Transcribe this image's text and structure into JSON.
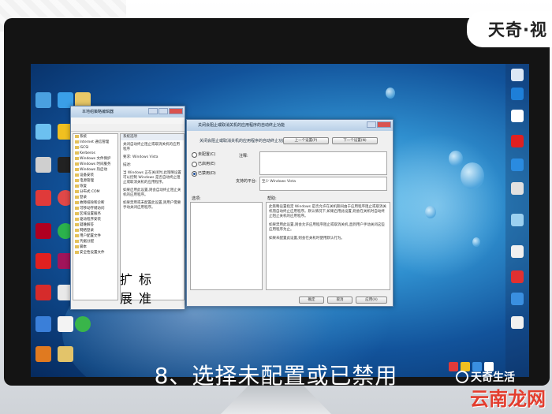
{
  "brand_top": "天奇·视",
  "caption": "8、选择未配置或已禁用",
  "watermark_brand": "天奇生活",
  "watermark_site": "云南龙网",
  "colors": {
    "accent_red": "#e33d2e",
    "title_bar": "#b8cfe7",
    "desktop_blue": "#12539b"
  },
  "gpedit": {
    "title": "本地组策略编辑器",
    "tree": [
      "系统",
      "Internet 通信管理",
      "iSCSI",
      "Kerberos",
      "Windows 文件保护",
      "Windows 时间服务",
      "Windows 热启动",
      "设备安装",
      "电源管理",
      "恢复",
      "分布式 COM",
      "登录",
      "故障排除和诊断",
      "可移动存储访问",
      "区域设置服务",
      "驱动程序安装",
      "疑难解答",
      "网络登录",
      "用户配置文件",
      "凭据分配",
      "脚本",
      "安全性设置文件"
    ],
    "detail_header": "系统选项",
    "detail_paragraphs": [
      "关闭自动终止阻止或取消关机的应用程序",
      "要求: Windows Vista",
      "描述:",
      "当 Windows 正在关闭时,此策略设置可以控制 Windows 是否自动终止阻止或取消关机的应用程序。",
      "如果启用此设置,则会自动终止阻止关机的应用程序。",
      "如果禁用或未配置此设置,则用户需要手动关闭应用程序。"
    ],
    "tabs": [
      "扩展",
      "标准"
    ]
  },
  "dialog": {
    "title": "关闭会阻止或取消关机的应用程序的自动终止功能",
    "heading": "关闭会阻止或取消关机的应用程序的自动终止功能",
    "prev_button": "上一个设置(P)",
    "next_button": "下一个设置(N)",
    "radio_not_configured": "未配置(C)",
    "radio_enabled": "已启用(E)",
    "radio_disabled": "已禁用(D)",
    "comment_label": "注释:",
    "supported_label": "支持的平台:",
    "supported_value": "至少 Windows Vista",
    "options_label": "选项:",
    "help_label": "帮助:",
    "help_paragraphs": [
      "此策略设置指定 Windows 是否允许在关机期间由于应用程序阻止或取消关机而自动终止应用程序。默认情况下,如果启用此设置,则会在关机时自动终止阻止关机的应用程序。",
      "如果禁用此设置,则会允许应用程序阻止或取消关机,直到用户手动关闭这些应用程序为止。",
      "如果未配置此设置,则会在关机时使用默认行为。"
    ],
    "ok_button": "确定",
    "cancel_button": "取消",
    "apply_button": "应用(A)"
  }
}
